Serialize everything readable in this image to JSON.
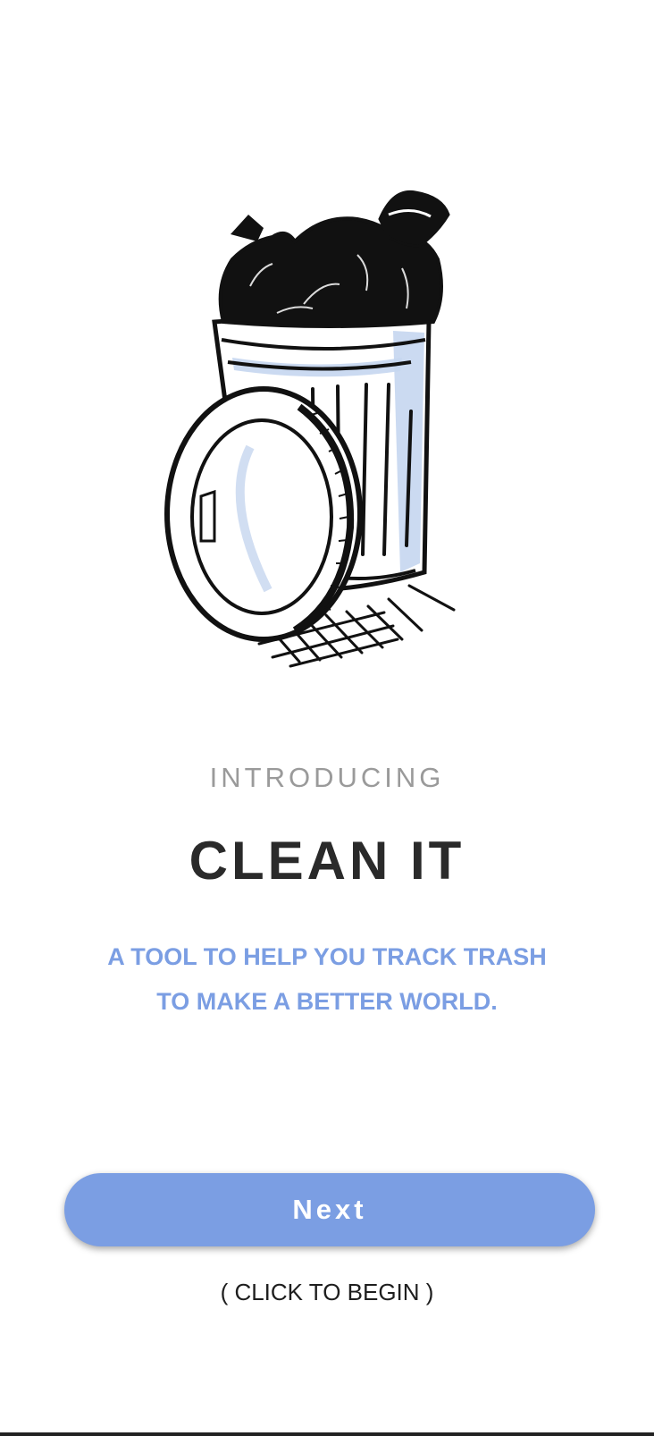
{
  "intro": {
    "eyebrow": "INTRODUCING",
    "title": "CLEAN IT",
    "tagline_line1": "A TOOL TO HELP YOU TRACK TRASH",
    "tagline_line2": "TO MAKE A BETTER WORLD."
  },
  "illustration": {
    "icon": "trash-can-illustration"
  },
  "actions": {
    "next_label": "Next",
    "hint": "( CLICK TO BEGIN )"
  },
  "colors": {
    "accent": "#7b9ee3",
    "title": "#2a2a2a",
    "eyebrow": "#9a9a9a",
    "background": "#ffffff"
  }
}
